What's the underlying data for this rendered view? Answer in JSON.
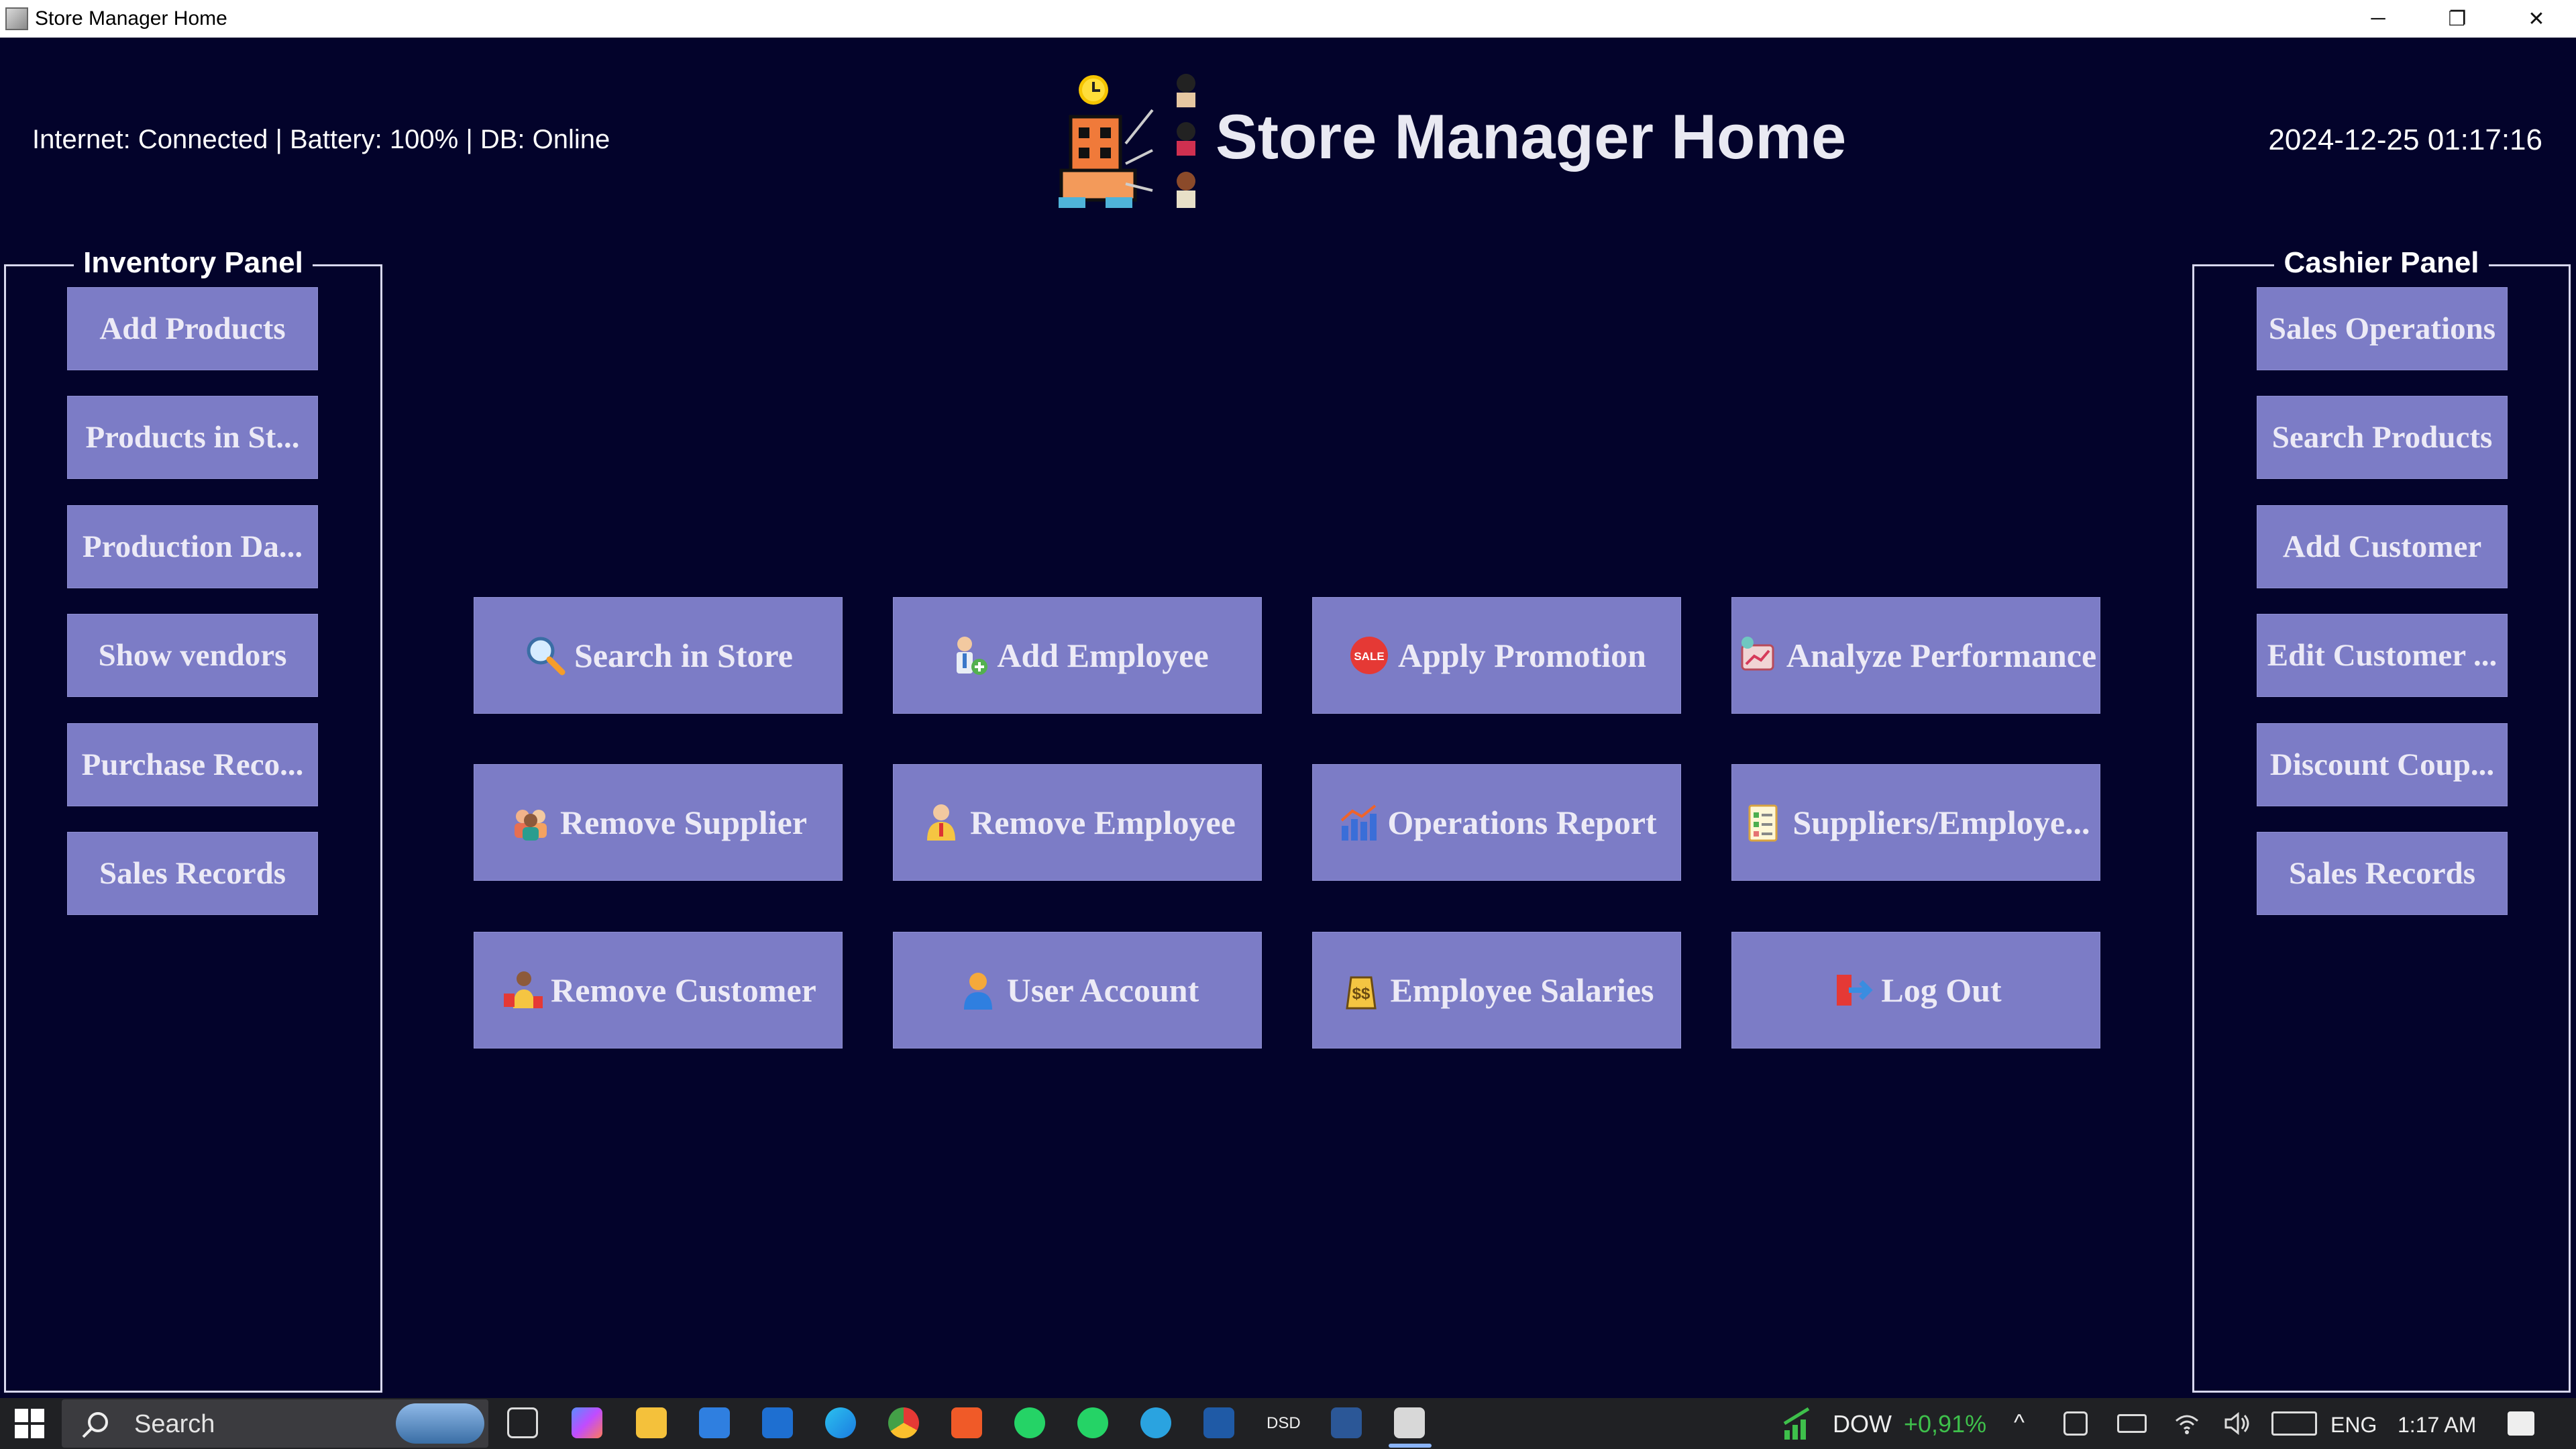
{
  "window": {
    "title": "Store Manager Home",
    "controls": [
      "─",
      "❐",
      "✕"
    ]
  },
  "header": {
    "status": "Internet: Connected | Battery: 100% | DB:  Online",
    "title": "Store Manager Home",
    "datetime": "2024-12-25 01:17:16"
  },
  "inventory_panel": {
    "title": "Inventory Panel",
    "buttons": [
      "Add Products",
      "Products in St...",
      "Production Da...",
      "Show vendors",
      "Purchase Reco...",
      "Sales Records"
    ]
  },
  "cashier_panel": {
    "title": "Cashier Panel",
    "buttons": [
      "Sales Operations",
      "Search Products",
      "Add Customer",
      "Edit Customer ...",
      "Discount Coup...",
      "Sales Records"
    ]
  },
  "actions": [
    {
      "label": "Search in Store",
      "icon": "magnifier-icon"
    },
    {
      "label": "Add Employee",
      "icon": "add-employee-icon"
    },
    {
      "label": "Apply Promotion",
      "icon": "sale-tag-icon"
    },
    {
      "label": "Analyze Performance",
      "icon": "analytics-icon"
    },
    {
      "label": "Remove Supplier",
      "icon": "suppliers-icon"
    },
    {
      "label": "Remove Employee",
      "icon": "employee-icon"
    },
    {
      "label": "Operations Report",
      "icon": "bar-chart-icon"
    },
    {
      "label": "Suppliers/Employe...",
      "icon": "checklist-icon"
    },
    {
      "label": "Remove Customer",
      "icon": "customer-icon"
    },
    {
      "label": "User Account",
      "icon": "user-icon"
    },
    {
      "label": "Employee Salaries",
      "icon": "salary-icon"
    },
    {
      "label": "Log Out",
      "icon": "logout-icon"
    }
  ],
  "taskbar": {
    "search": "Search",
    "ticker_name": "DOW",
    "ticker_value": "+0,91%",
    "lang": "ENG",
    "time": "1:17 AM",
    "dsd": "DSD"
  },
  "colors": {
    "background": "#03032b",
    "button": "#7c7cc6",
    "button_text": "#eceaf6",
    "ticker_up": "#3ec04b"
  }
}
